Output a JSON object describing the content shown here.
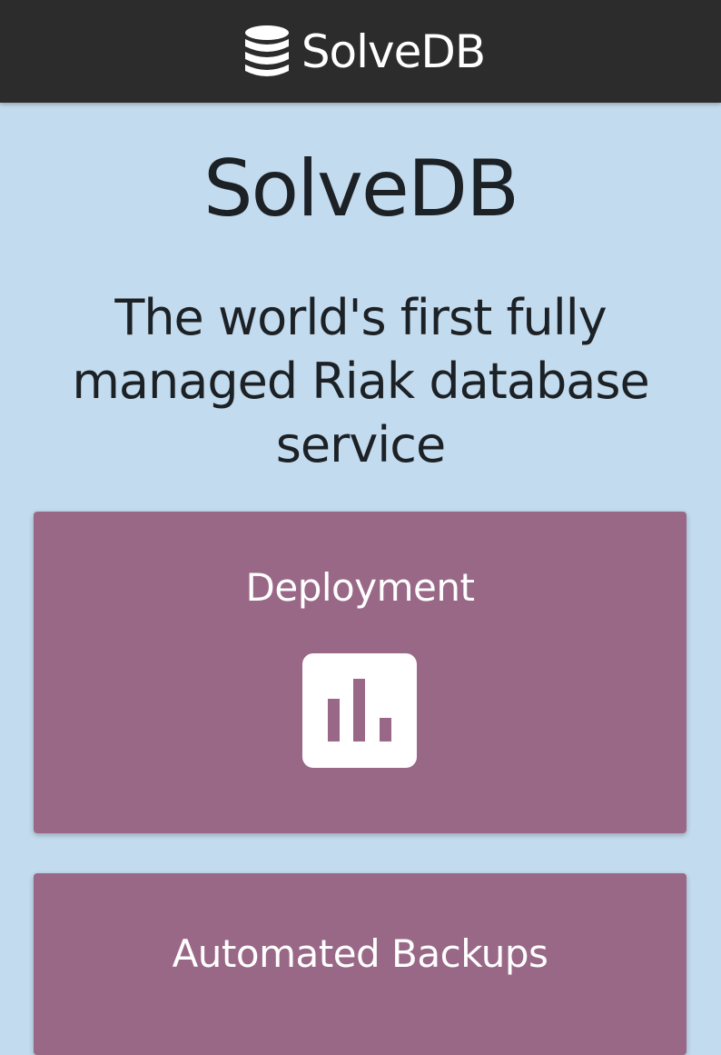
{
  "navbar": {
    "brand_name": "SolveDB",
    "brand_icon": "database-icon"
  },
  "hero": {
    "title": "SolveDB",
    "subtitle": "The world's first fully managed Riak database service"
  },
  "features": [
    {
      "title": "Deployment",
      "icon": "bar-chart-icon"
    },
    {
      "title": "Automated Backups"
    }
  ],
  "colors": {
    "navbar_bg": "#2c2c2c",
    "page_bg": "#c3dbee",
    "card_bg": "#9a6887",
    "text_dark": "#1c2126",
    "text_light": "#ffffff"
  }
}
